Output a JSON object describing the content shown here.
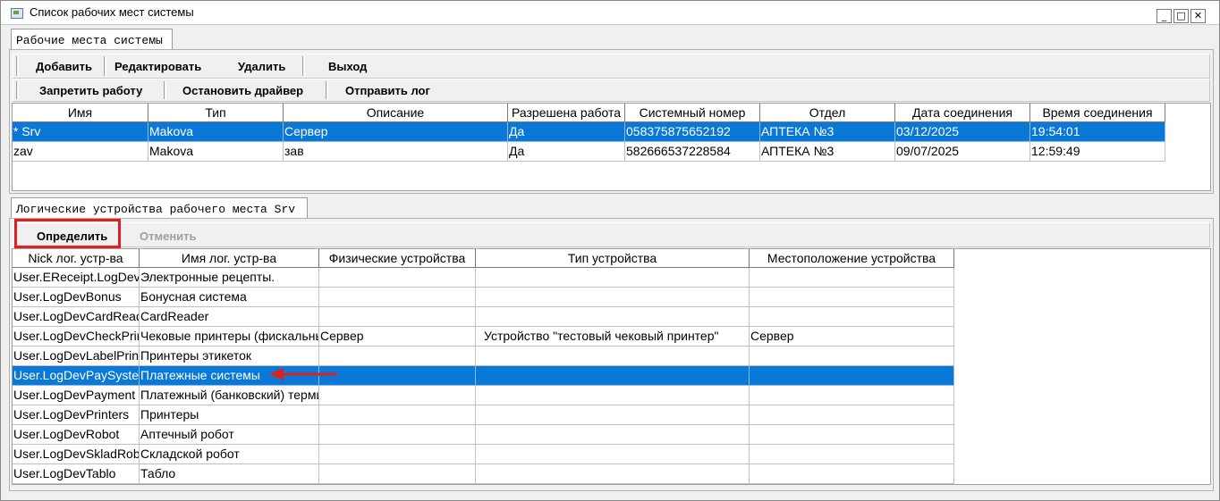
{
  "window": {
    "title": "Список рабочих мест системы",
    "minimize": "_",
    "maximize": "□",
    "close": "✕",
    "icon": "app-window-icon"
  },
  "top_tab": {
    "label": "Рабочие места системы"
  },
  "toolbar1": [
    "Добавить",
    "Редактировать",
    "Удалить",
    "Выход"
  ],
  "toolbar2": [
    "Запретить работу",
    "Остановить драйвер",
    "Отправить лог"
  ],
  "workplaces": {
    "columns": [
      "Имя",
      "Тип",
      "Описание",
      "Разрешена работа",
      "Системный номер",
      "Отдел",
      "Дата соединения",
      "Время соединения"
    ],
    "rows": [
      [
        "* Srv",
        "Makova",
        "Сервер",
        "Да",
        "058375875652192",
        "АПТЕКА  №3",
        "03/12/2025",
        "19:54:01"
      ],
      [
        "zav",
        "Makova",
        "зав",
        "Да",
        "582666537228584",
        "АПТЕКА  №3",
        "09/07/2025",
        "12:59:49"
      ]
    ],
    "selected_row": 0
  },
  "bottom_tab": {
    "label": "Логические устройства рабочего места Srv"
  },
  "device_toolbar": {
    "define": "Определить",
    "cancel": "Отменить"
  },
  "devices": {
    "columns": [
      "Nick лог. устр-ва",
      "Имя лог. устр-ва",
      "Физические устройства",
      "Тип устройства",
      "Местоположение устройства"
    ],
    "rows": [
      [
        "User.EReceipt.LogDev",
        "Электронные рецепты.",
        "",
        "",
        ""
      ],
      [
        "User.LogDevBonus",
        "Бонусная система",
        "",
        "",
        ""
      ],
      [
        "User.LogDevCardReader",
        "CardReader",
        "",
        "",
        ""
      ],
      [
        "User.LogDevCheckPrinter",
        "Чековые принтеры (фискальные)",
        "Сервер",
        "Устройство \"тестовый чековый принтер\"",
        "Сервер"
      ],
      [
        "User.LogDevLabelPrinter",
        "Принтеры этикеток",
        "",
        "",
        ""
      ],
      [
        "User.LogDevPaySystem",
        "Платежные системы",
        "",
        "",
        ""
      ],
      [
        "User.LogDevPayment",
        "Платежный (банковский) терминал",
        "",
        "",
        ""
      ],
      [
        "User.LogDevPrinters",
        "Принтеры",
        "",
        "",
        ""
      ],
      [
        "User.LogDevRobot",
        "Аптечный робот",
        "",
        "",
        ""
      ],
      [
        "User.LogDevSkladRobot",
        "Складской робот",
        "",
        "",
        ""
      ],
      [
        "User.LogDevTablo",
        "Табло",
        "",
        "",
        ""
      ]
    ],
    "selected_row": 5
  },
  "annotation": {
    "color": "#e02020",
    "arrow_icon": "red-arrow-left-icon"
  }
}
